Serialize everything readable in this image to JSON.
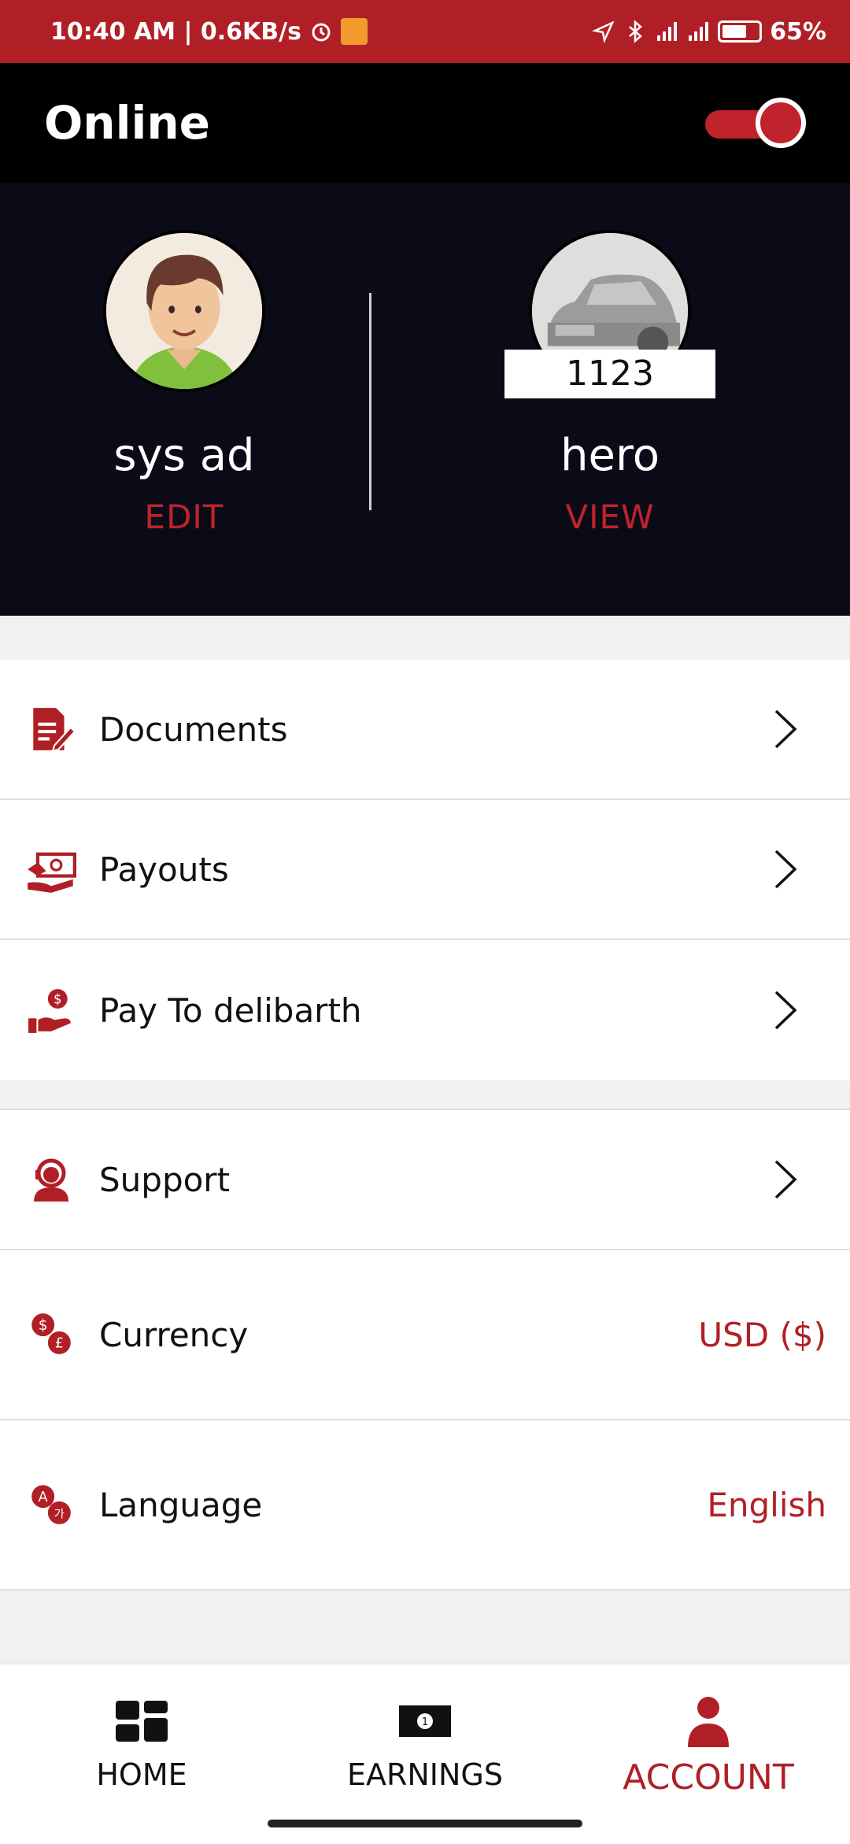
{
  "status_bar": {
    "time_speed": "10:40 AM | 0.6KB/s",
    "battery": "65%"
  },
  "header": {
    "title": "Online",
    "online_toggle_on": true
  },
  "profile": {
    "user": {
      "name": "sys ad",
      "action": "EDIT"
    },
    "vehicle": {
      "plate": "1123",
      "name": "hero",
      "action": "VIEW"
    }
  },
  "menu_group_1": [
    {
      "label": "Documents",
      "icon": "documents-icon"
    },
    {
      "label": "Payouts",
      "icon": "payouts-icon"
    },
    {
      "label": "Pay To delibarth",
      "icon": "pay-to-icon"
    }
  ],
  "menu_group_2": [
    {
      "label": "Support",
      "icon": "support-icon"
    },
    {
      "label": "Currency",
      "value": "USD ($)",
      "icon": "currency-icon"
    },
    {
      "label": "Language",
      "value": "English",
      "icon": "language-icon"
    }
  ],
  "bottom_nav": [
    {
      "label": "HOME",
      "icon": "home-grid-icon"
    },
    {
      "label": "EARNINGS",
      "icon": "banknote-icon"
    },
    {
      "label": "ACCOUNT",
      "icon": "person-icon",
      "active": true
    }
  ],
  "colors": {
    "accent": "#b11f26",
    "header_bg": "#000000",
    "profile_bg": "#0b0b18"
  }
}
